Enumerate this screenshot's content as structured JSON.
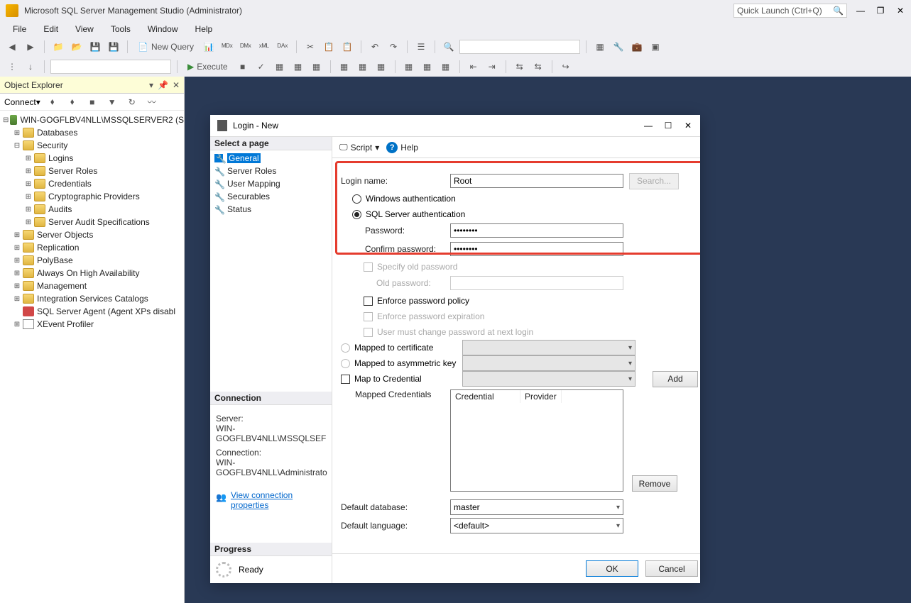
{
  "titlebar": {
    "title": "Microsoft SQL Server Management Studio (Administrator)",
    "quick_launch_placeholder": "Quick Launch (Ctrl+Q)"
  },
  "menubar": [
    "File",
    "Edit",
    "View",
    "Tools",
    "Window",
    "Help"
  ],
  "toolbar": {
    "new_query": "New Query",
    "execute": "Execute"
  },
  "object_explorer": {
    "title": "Object Explorer",
    "connect": "Connect",
    "root": "WIN-GOGFLBV4NLL\\MSSQLSERVER2 (S",
    "nodes": {
      "databases": "Databases",
      "security": "Security",
      "security_children": [
        "Logins",
        "Server Roles",
        "Credentials",
        "Cryptographic Providers",
        "Audits",
        "Server Audit Specifications"
      ],
      "rest": [
        "Server Objects",
        "Replication",
        "PolyBase",
        "Always On High Availability",
        "Management",
        "Integration Services Catalogs"
      ],
      "agent": "SQL Server Agent (Agent XPs disabl",
      "xevent": "XEvent Profiler"
    }
  },
  "dialog": {
    "title": "Login - New",
    "select_page": "Select a page",
    "pages": [
      "General",
      "Server Roles",
      "User Mapping",
      "Securables",
      "Status"
    ],
    "script": "Script",
    "help": "Help",
    "connection": {
      "header": "Connection",
      "server_label": "Server:",
      "server_value": "WIN-GOGFLBV4NLL\\MSSQLSEF",
      "connection_label": "Connection:",
      "connection_value": "WIN-GOGFLBV4NLL\\Administrato",
      "view_props": "View connection properties"
    },
    "progress": {
      "header": "Progress",
      "status": "Ready"
    },
    "form": {
      "login_name_label": "Login name:",
      "login_name_value": "Root",
      "search": "Search...",
      "windows_auth": "Windows authentication",
      "sql_auth": "SQL Server authentication",
      "password_label": "Password:",
      "password_value": "●●●●●●●●",
      "confirm_label": "Confirm password:",
      "confirm_value": "●●●●●●●●",
      "specify_old": "Specify old password",
      "old_password_label": "Old password:",
      "enforce_policy": "Enforce password policy",
      "enforce_expiration": "Enforce password expiration",
      "must_change": "User must change password at next login",
      "mapped_cert": "Mapped to certificate",
      "mapped_asym": "Mapped to asymmetric key",
      "map_cred": "Map to Credential",
      "add": "Add",
      "mapped_creds": "Mapped Credentials",
      "cred_col1": "Credential",
      "cred_col2": "Provider",
      "remove": "Remove",
      "default_db_label": "Default database:",
      "default_db_value": "master",
      "default_lang_label": "Default language:",
      "default_lang_value": "<default>"
    },
    "footer": {
      "ok": "OK",
      "cancel": "Cancel"
    }
  }
}
